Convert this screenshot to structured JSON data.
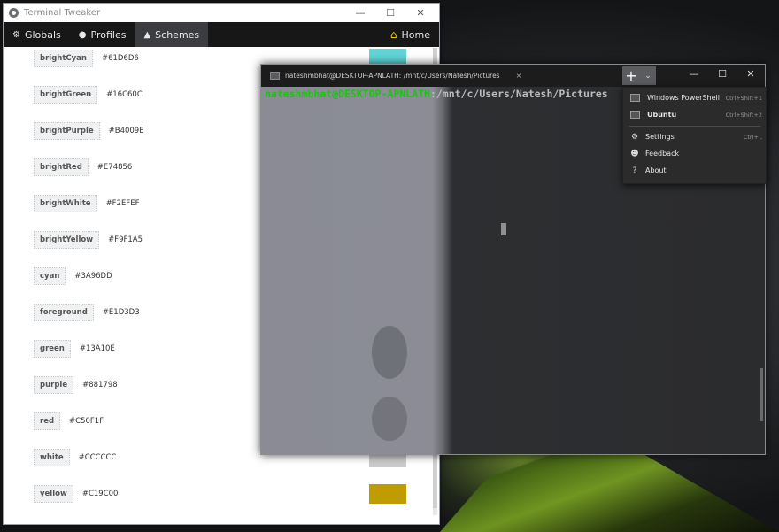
{
  "tweaker": {
    "title": "Terminal Tweaker",
    "window_buttons": {
      "minimize": "—",
      "maximize": "☐",
      "close": "✕"
    },
    "nav": {
      "tabs": [
        {
          "label": "Globals",
          "icon": "gear-icon",
          "glyph": "⚙"
        },
        {
          "label": "Profiles",
          "icon": "user-icon",
          "glyph": "👤"
        },
        {
          "label": "Schemes",
          "icon": "droplet-icon",
          "glyph": "💧"
        }
      ],
      "active_tab": "Schemes",
      "home": {
        "label": "Home",
        "icon": "home-icon",
        "glyph": "⌂"
      }
    },
    "colors": [
      {
        "name": "brightCyan",
        "hex": "#61D6D6"
      },
      {
        "name": "brightGreen",
        "hex": "#16C60C"
      },
      {
        "name": "brightPurple",
        "hex": "#B4009E"
      },
      {
        "name": "brightRed",
        "hex": "#E74856"
      },
      {
        "name": "brightWhite",
        "hex": "#F2EFEF"
      },
      {
        "name": "brightYellow",
        "hex": "#F9F1A5"
      },
      {
        "name": "cyan",
        "hex": "#3A96DD"
      },
      {
        "name": "foreground",
        "hex": "#E1D3D3"
      },
      {
        "name": "green",
        "hex": "#13A10E"
      },
      {
        "name": "purple",
        "hex": "#881798"
      },
      {
        "name": "red",
        "hex": "#C50F1F"
      },
      {
        "name": "white",
        "hex": "#CCCCCC"
      },
      {
        "name": "yellow",
        "hex": "#C19C00"
      }
    ]
  },
  "terminal": {
    "tab_title": "nateshmbhat@DESKTOP-APNLATH: /mnt/c/Users/Natesh/Pictures",
    "tab_close": "×",
    "new_tab_glyph": "+",
    "dropdown_glyph": "⌄",
    "window_buttons": {
      "minimize": "—",
      "maximize": "☐",
      "close": "✕"
    },
    "prompt_user": "nateshmbhat@DESKTOP-APNLATH",
    "prompt_path": ":/mnt/c/Users/Natesh/Pictures"
  },
  "menu": {
    "items": [
      {
        "label": "Windows PowerShell",
        "shortcut": "Ctrl+Shift+1",
        "icon": "powershell-icon",
        "bold": false
      },
      {
        "label": "Ubuntu",
        "shortcut": "Ctrl+Shift+2",
        "icon": "terminal-icon",
        "bold": true
      },
      {
        "label": "Settings",
        "shortcut": "Ctrl+ ,",
        "icon": "gear-icon",
        "glyph": "⚙"
      },
      {
        "label": "Feedback",
        "shortcut": "",
        "icon": "feedback-icon",
        "glyph": "☻"
      },
      {
        "label": "About",
        "shortcut": "",
        "icon": "question-icon",
        "glyph": "?"
      }
    ]
  }
}
